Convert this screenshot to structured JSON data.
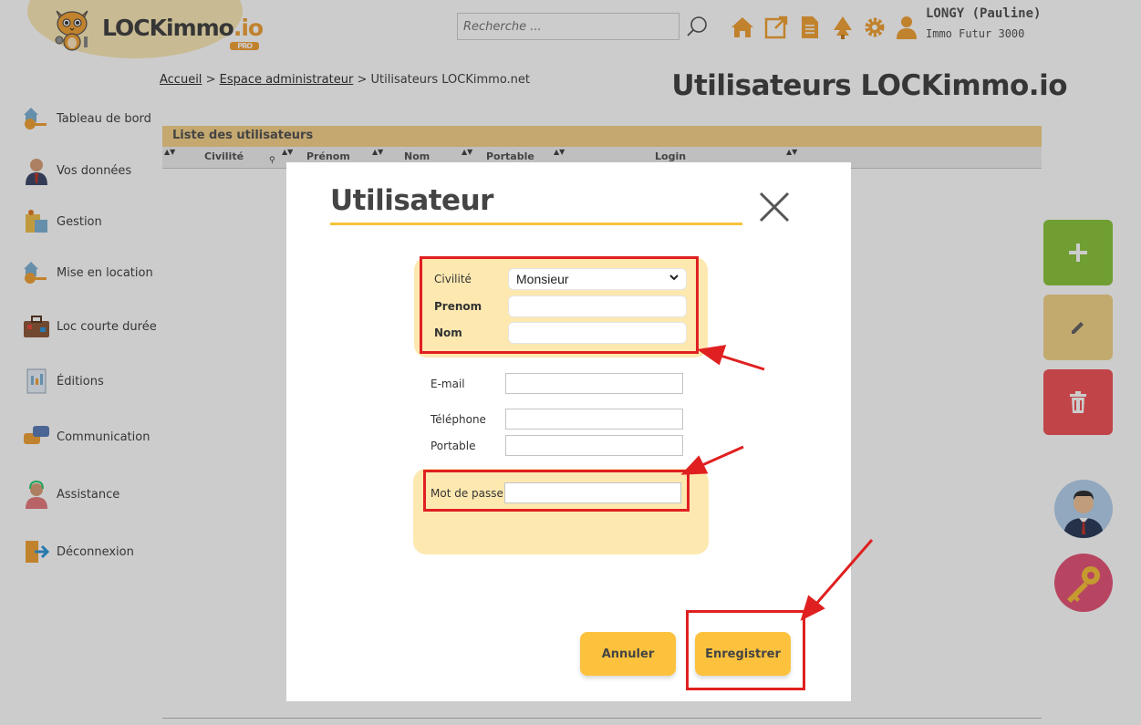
{
  "header": {
    "logo": {
      "name": "LOCKimmo",
      "suffix": ".io",
      "badge": "PRO"
    },
    "search": {
      "placeholder": "Recherche ..."
    },
    "user": {
      "name": "LONGY (Pauline)",
      "company": "Immo Futur 3000"
    },
    "accent_color": "#f2a33a"
  },
  "breadcrumb": {
    "items": [
      "Accueil",
      "Espace administrateur",
      "Utilisateurs LOCKimmo.net"
    ],
    "separator": ">"
  },
  "page_title": "Utilisateurs LOCKimmo.io",
  "sidebar": {
    "items": [
      {
        "label": "Tableau de bord",
        "icon": "house-key-icon"
      },
      {
        "label": "Vos données",
        "icon": "person-icon"
      },
      {
        "label": "Gestion",
        "icon": "folder-icon"
      },
      {
        "label": "Mise en location",
        "icon": "house-key-icon"
      },
      {
        "label": "Loc courte durée",
        "icon": "suitcase-icon"
      },
      {
        "label": "Éditions",
        "icon": "document-icon"
      },
      {
        "label": "Communication",
        "icon": "chat-bubbles-icon"
      },
      {
        "label": "Assistance",
        "icon": "support-agent-icon"
      },
      {
        "label": "Déconnexion",
        "icon": "logout-icon"
      }
    ]
  },
  "table": {
    "title": "Liste des utilisateurs",
    "columns": [
      "Civilité",
      "Prénom",
      "Nom",
      "Portable",
      "Login"
    ]
  },
  "modal": {
    "title": "Utilisateur",
    "fields": {
      "civilite": {
        "label": "Civilité",
        "value": "Monsieur"
      },
      "prenom": {
        "label": "Prenom",
        "value": ""
      },
      "nom": {
        "label": "Nom",
        "value": ""
      },
      "email": {
        "label": "E-mail",
        "value": ""
      },
      "telephone": {
        "label": "Téléphone",
        "value": ""
      },
      "portable": {
        "label": "Portable",
        "value": ""
      },
      "password": {
        "label": "Mot de passe",
        "value": ""
      }
    },
    "buttons": {
      "cancel": "Annuler",
      "save": "Enregistrer"
    }
  },
  "right_actions": {
    "add_color": "#8dc63f",
    "edit_color": "#f3d58b",
    "delete_color": "#f2555a"
  },
  "annotation_color": "#e02020"
}
